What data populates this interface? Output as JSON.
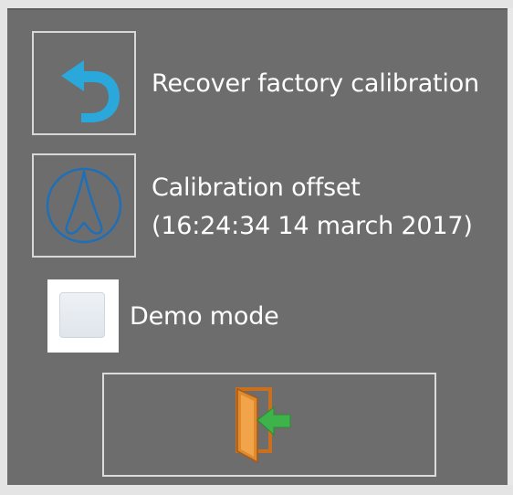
{
  "settings": {
    "recover_factory_calibration": {
      "label": "Recover factory calibration",
      "icon": "undo-arrow-icon"
    },
    "calibration_offset": {
      "label": "Calibration offset",
      "timestamp": "(16:24:34 14 march 2017)",
      "icon": "calibration-icon"
    },
    "demo_mode": {
      "label": "Demo mode",
      "checked": false
    },
    "exit": {
      "icon": "exit-door-icon"
    }
  },
  "colors": {
    "panel": "#6d6d6d",
    "text": "#ffffff",
    "accent_blue": "#2aa8dc",
    "exit_arrow": "#3db34a",
    "door": "#d9822b"
  }
}
